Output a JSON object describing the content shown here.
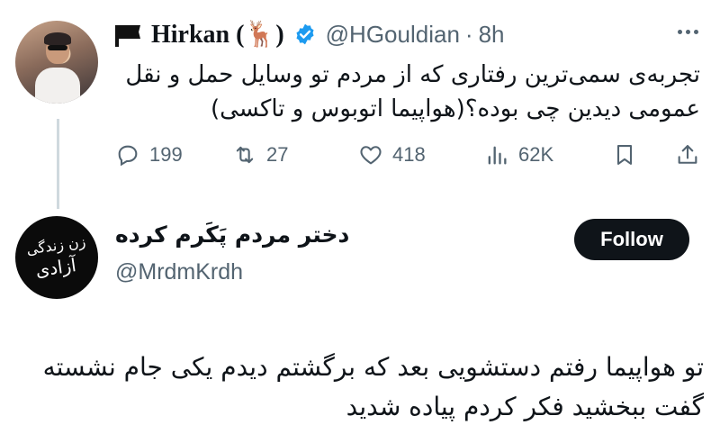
{
  "tweet_main": {
    "display_name": "Hirkan (🦌)",
    "handle": "@HGouldian",
    "separator": "·",
    "time": "8h",
    "text": "تجربه‌ی سمی‌ترین رفتاری که از مردم تو وسایل حمل و نقل عمومی دیدین چی بوده؟(هواپیما اتوبوس و تاکسی)",
    "icons": {
      "flag": "black-flag-icon",
      "verified": "verified-badge-icon",
      "more": "more-icon"
    },
    "colors": {
      "verified": "#1d9bf0",
      "muted": "#536471"
    },
    "stats": {
      "replies": "199",
      "retweets": "27",
      "likes": "418",
      "views": "62K"
    }
  },
  "tweet_reply": {
    "display_name": "دختر مردم پَکَرم کرده",
    "handle": "@MrdmKrdh",
    "follow_label": "Follow",
    "avatar_text_line1": "زن زندگی",
    "avatar_text_line2": "آزادی",
    "text": "تو هواپیما رفتم دستشویی بعد که برگشتم دیدم یکی جام نشسته گفت ببخشید فکر کردم پیاده شدید"
  }
}
